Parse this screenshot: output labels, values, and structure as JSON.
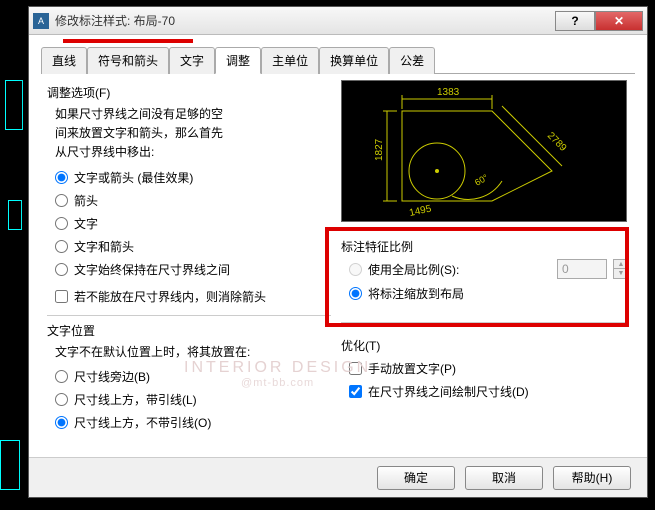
{
  "window": {
    "title": "修改标注样式: 布局-70",
    "icon": "A"
  },
  "tabs": {
    "items": [
      "直线",
      "符号和箭头",
      "文字",
      "调整",
      "主单位",
      "换算单位",
      "公差"
    ],
    "active": "调整"
  },
  "fit": {
    "section_label": "调整选项(F)",
    "desc_l1": "如果尺寸界线之间没有足够的空",
    "desc_l2": "间来放置文字和箭头，那么首先",
    "desc_l3": "从尺寸界线中移出:",
    "opt1": "文字或箭头 (最佳效果)",
    "opt2": "箭头",
    "opt3": "文字",
    "opt4": "文字和箭头",
    "opt5": "文字始终保持在尺寸界线之间",
    "suppress": "若不能放在尺寸界线内，则消除箭头"
  },
  "textpos": {
    "section_label": "文字位置",
    "desc": "文字不在默认位置上时，将其放置在:",
    "opt1": "尺寸线旁边(B)",
    "opt2": "尺寸线上方，带引线(L)",
    "opt3": "尺寸线上方，不带引线(O)"
  },
  "scale": {
    "section_label": "标注特征比例",
    "opt1": "使用全局比例(S):",
    "value": "0",
    "opt2": "将标注缩放到布局"
  },
  "finetune": {
    "section_label": "优化(T)",
    "opt1": "手动放置文字(P)",
    "opt2": "在尺寸界线之间绘制尺寸线(D)"
  },
  "preview": {
    "dim_top": "1383",
    "dim_left": "1827",
    "dim_right": "2789",
    "dim_angle": "60°",
    "dim_bottom": "1495"
  },
  "watermark": {
    "line1": "INTERIOR DESIGN",
    "line2": "@mt-bb.com"
  },
  "buttons": {
    "ok": "确定",
    "cancel": "取消",
    "help": "帮助(H)"
  }
}
